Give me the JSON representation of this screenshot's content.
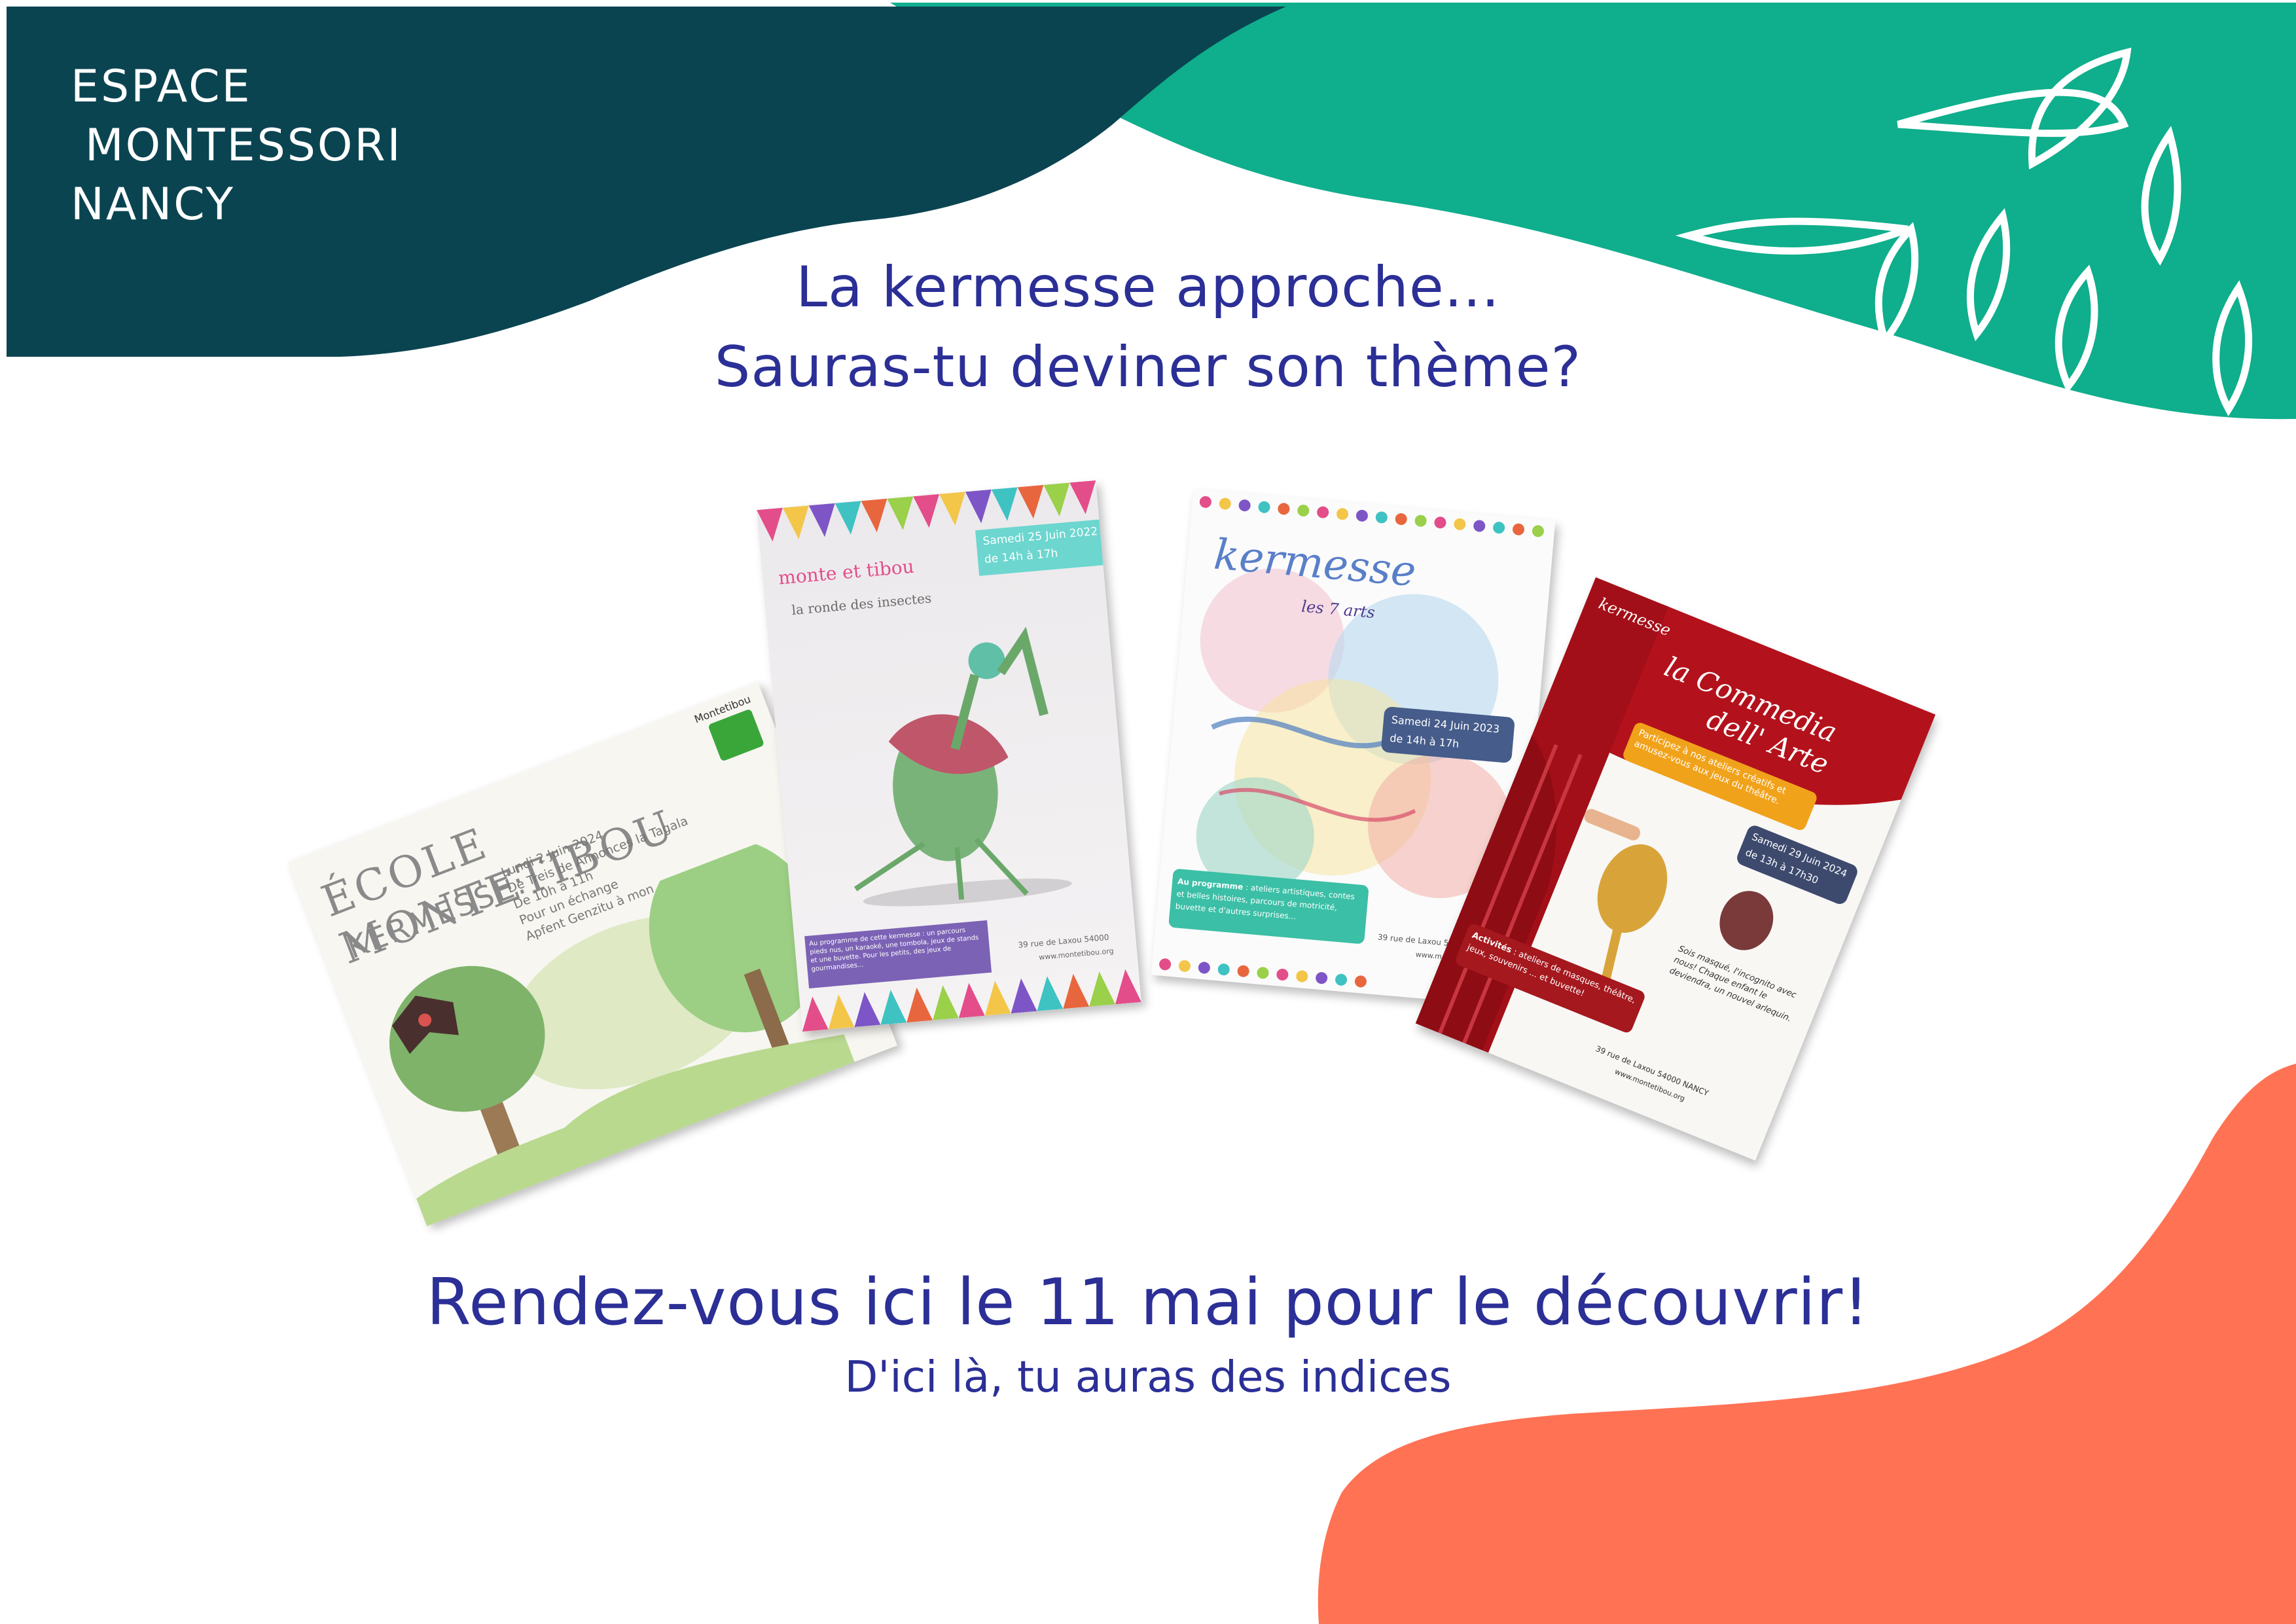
{
  "logo": {
    "line1": "ESPACE",
    "line2": "MONTESSORI",
    "line3": "NANCY"
  },
  "headline": {
    "line1": "La kermesse approche...",
    "line2": "Sauras-tu deviner son thème?"
  },
  "cta": {
    "main": "Rendez-vous ici le 11 mai pour le découvrir!",
    "sub": "D'ici là, tu auras des indices"
  },
  "colors": {
    "dark_teal": "#0b4451",
    "green": "#0fae8c",
    "coral": "#ff7254",
    "headline_blue": "#2b2f96",
    "poster_red": "#b3121c"
  },
  "posters": {
    "p1": {
      "title": "ÉCOLE MONTETIBOU",
      "kermesse": "KERMESSE:",
      "notes": [
        "Lundi 2 Juin 2024",
        "De Treis de Annonces la Tagala",
        "De 10h à 11h",
        "Pour un échange ",
        "Apfent Genzitu à mon"
      ],
      "brand": "Montetibou",
      "logo_icon": "montetibou-logo-icon"
    },
    "p2": {
      "brand": "monte et tibou",
      "theme": "la ronde des insectes",
      "date": "Samedi 25 Juin 2022",
      "hours": "de 14h à 17h",
      "program": "Au programme de cette kermesse : un parcours pieds nus, un karaoké, une tombola, jeux de stands et une buvette. Pour les petits, des jeux de gourmandises...",
      "address": "39 rue de Laxou 54000",
      "site": "www.montetibou.org",
      "image": "praying-mantis-photo"
    },
    "p3": {
      "title": "kermesse",
      "theme": "les 7 arts",
      "date": "Samedi 24 Juin 2023",
      "hours": "de 14h à 17h",
      "program_label": "Au programme",
      "program": " : ateliers artistiques, contes et belles histoires, parcours de motricité, buvette et d'autres surprises...",
      "address": "39 rue de Laxou 54000 N...",
      "site": "www.montet..."
    },
    "p4": {
      "small_title": "kermesse",
      "title_line1": "la Commedia",
      "title_line2": "dell' Arte",
      "invite": "Participez à nos ateliers créatifs et amusez-vous aux jeux du théâtre.",
      "date": "Samedi 29 Juin 2024",
      "hours": "de 13h à 17h30",
      "activities_label": "Activités",
      "activities": " : ateliers de masques, théâtre, jeux, souvenirs ... et buvette!",
      "quote": "Sois masqué, l'incognito avec nous! Chaque enfant le deviendra, un nouvel arlequin.",
      "address": "39 rue de Laxou 54000 NANCY",
      "site": "www.montetibou.org"
    }
  }
}
